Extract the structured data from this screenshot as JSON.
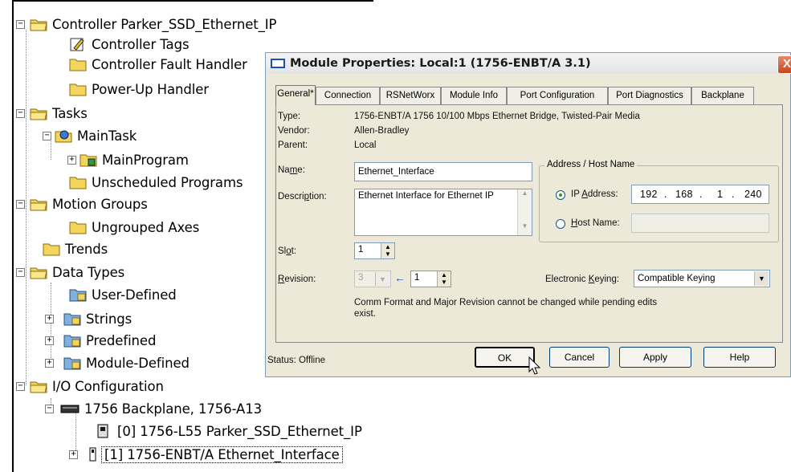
{
  "tree": {
    "nodes": [
      {
        "label": "Controller Parker_SSD_Ethernet_IP",
        "expander": "−",
        "icon": "open-folder-icon"
      },
      {
        "label": "Controller Tags",
        "icon": "tags-icon"
      },
      {
        "label": "Controller Fault Handler",
        "icon": "folder-icon"
      },
      {
        "label": "Power-Up Handler",
        "icon": "folder-icon"
      },
      {
        "label": "Tasks",
        "expander": "−",
        "icon": "open-folder-icon"
      },
      {
        "label": "MainTask",
        "expander": "−",
        "icon": "task-icon"
      },
      {
        "label": "MainProgram",
        "expander": "+",
        "icon": "program-icon"
      },
      {
        "label": "Unscheduled Programs",
        "icon": "folder-icon"
      },
      {
        "label": "Motion Groups",
        "expander": "−",
        "icon": "open-folder-icon"
      },
      {
        "label": "Ungrouped Axes",
        "icon": "folder-icon"
      },
      {
        "label": "Trends",
        "icon": "folder-icon"
      },
      {
        "label": "Data Types",
        "expander": "−",
        "icon": "open-folder-icon"
      },
      {
        "label": "User-Defined",
        "icon": "datatype-icon"
      },
      {
        "label": "Strings",
        "expander": "+",
        "icon": "datatype-icon"
      },
      {
        "label": "Predefined",
        "expander": "+",
        "icon": "datatype-icon"
      },
      {
        "label": "Module-Defined",
        "expander": "+",
        "icon": "datatype-icon"
      },
      {
        "label": "I/O Configuration",
        "expander": "−",
        "icon": "open-folder-icon"
      },
      {
        "label": "1756 Backplane, 1756-A13",
        "expander": "−",
        "icon": "backplane-icon"
      },
      {
        "label": "[0] 1756-L55 Parker_SSD_Ethernet_IP",
        "icon": "controller-module-icon"
      },
      {
        "label": "[1] 1756-ENBT/A Ethernet_Interface",
        "expander": "+",
        "icon": "module-icon",
        "selected": true
      }
    ]
  },
  "dialog": {
    "title": "Module Properties: Local:1 (1756-ENBT/A 3.1)",
    "close_label": "X",
    "tabs": [
      "General*",
      "Connection",
      "RSNetWorx",
      "Module Info",
      "Port Configuration",
      "Port Diagnostics",
      "Backplane"
    ],
    "type_label": "Type:",
    "type_value": "1756-ENBT/A 1756 10/100 Mbps Ethernet Bridge, Twisted-Pair Media",
    "vendor_label": "Vendor:",
    "vendor_value": "Allen-Bradley",
    "parent_label": "Parent:",
    "parent_value": "Local",
    "name_label_pre": "Na",
    "name_label_u": "m",
    "name_label_post": "e:",
    "name_value": "Ethernet_Interface",
    "desc_label_pre": "Descri",
    "desc_label_u": "p",
    "desc_label_post": "tion:",
    "desc_value": "Ethernet Interface for Ethernet IP",
    "slot_label_pre": "Sl",
    "slot_label_u": "o",
    "slot_label_post": "t:",
    "slot_value": "1",
    "revision_label_pre": "",
    "revision_label_u": "R",
    "revision_label_post": "evision:",
    "revision_major": "3",
    "revision_minor": "1",
    "address_group": "Address / Host Name",
    "ip_label_pre": "IP ",
    "ip_label_u": "A",
    "ip_label_post": "ddress:",
    "ip_octets": [
      "192",
      "168",
      "1",
      "240"
    ],
    "host_label_pre": "",
    "host_label_u": "H",
    "host_label_post": "ost Name:",
    "host_value": "",
    "keying_label_pre": "Electronic ",
    "keying_label_u": "K",
    "keying_label_post": "eying:",
    "keying_value": "Compatible Keying",
    "note_line1": "Comm Format and Major Revision cannot be changed while pending edits",
    "note_line2": "exist.",
    "status": "Status:  Offline",
    "buttons": {
      "ok": "OK",
      "cancel": "Cancel",
      "apply": "Apply",
      "help": "Help"
    }
  }
}
